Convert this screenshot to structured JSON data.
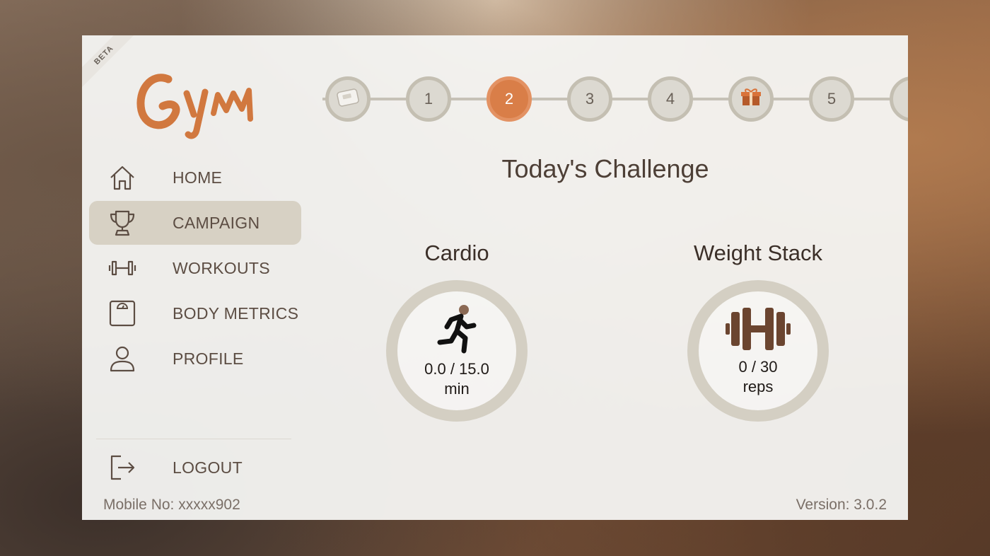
{
  "brand": {
    "beta": "BETA",
    "logo_text": "Gym"
  },
  "nav": {
    "items": [
      {
        "label": "HOME",
        "icon": "home-icon"
      },
      {
        "label": "CAMPAIGN",
        "icon": "trophy-icon"
      },
      {
        "label": "WORKOUTS",
        "icon": "dumbbell-icon"
      },
      {
        "label": "BODY METRICS",
        "icon": "scale-icon"
      },
      {
        "label": "PROFILE",
        "icon": "person-icon"
      }
    ],
    "active": "CAMPAIGN",
    "logout": "LOGOUT"
  },
  "footer": {
    "mobile": "Mobile No: xxxxx902",
    "version": "Version: 3.0.2"
  },
  "progress": {
    "steps": [
      {
        "label": "",
        "icon": "scale-device-icon"
      },
      {
        "label": "1"
      },
      {
        "label": "2",
        "current": true
      },
      {
        "label": "3"
      },
      {
        "label": "4"
      },
      {
        "label": "",
        "icon": "gift-icon"
      },
      {
        "label": "5"
      }
    ]
  },
  "challenge": {
    "title": "Today's Challenge",
    "cardio": {
      "title": "Cardio",
      "value": "0.0 / 15.0",
      "unit": "min",
      "icon": "running-icon"
    },
    "weight": {
      "title": "Weight Stack",
      "value": "0 / 30",
      "unit": "reps",
      "icon": "barbell-icon"
    }
  },
  "colors": {
    "accent": "#d97e48",
    "active_nav": "#d7d1c4",
    "text": "#5c4d43"
  }
}
